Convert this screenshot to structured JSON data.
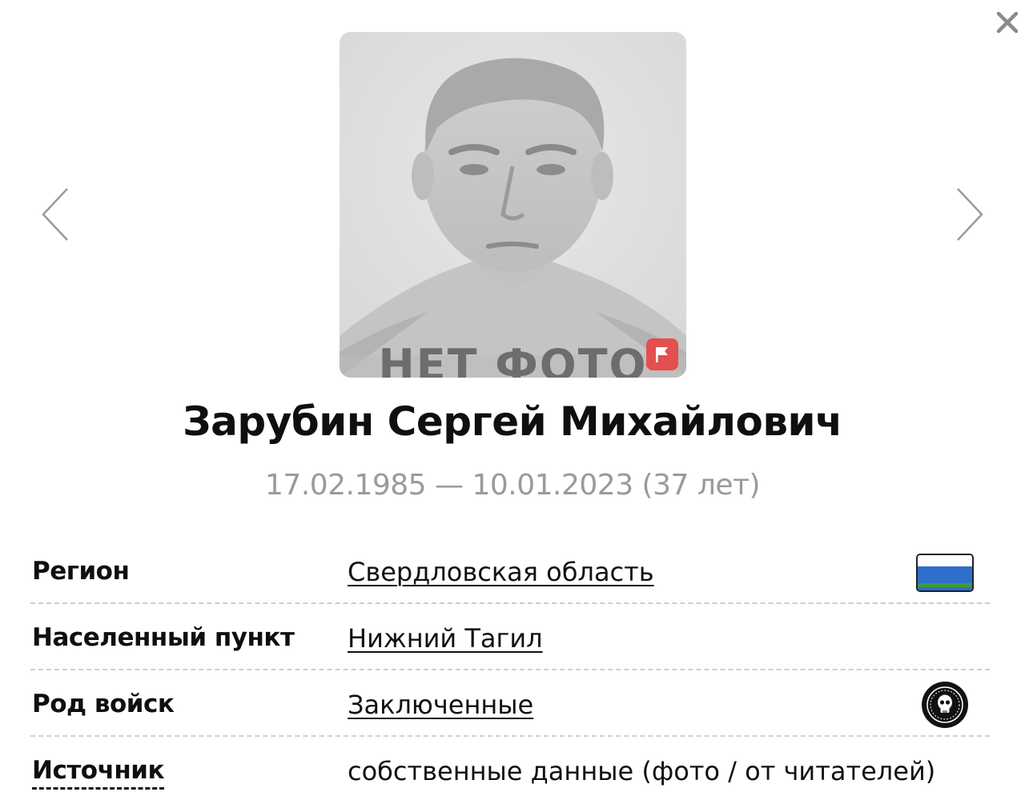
{
  "photo": {
    "placeholder_text": "НЕТ ФОТО",
    "flag_icon": "flag-icon",
    "badge_color": "#e44f4f"
  },
  "person": {
    "name": "Зарубин Сергей Михайлович",
    "dates": "17.02.1985 — 10.01.2023 (37 лет)"
  },
  "info": {
    "region": {
      "label": "Регион",
      "value": "Свердловская область",
      "icon": "region-flag-icon"
    },
    "settlement": {
      "label": "Населенный пункт",
      "value": "Нижний Тагил"
    },
    "troops": {
      "label": "Род войск",
      "value": "Заключенные",
      "icon": "skull-emblem-icon"
    },
    "source": {
      "label": "Источник",
      "value": "собственные данные (фото / от читателей)"
    }
  },
  "icons": {
    "close": "close-icon",
    "prev": "chevron-left-icon",
    "next": "chevron-right-icon"
  }
}
